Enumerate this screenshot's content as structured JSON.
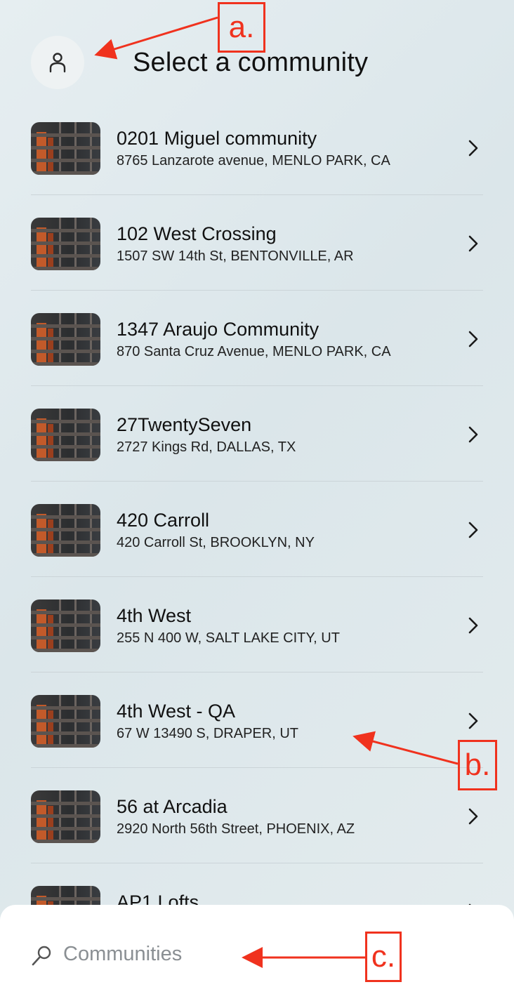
{
  "header": {
    "title": "Select a community",
    "profile_icon": "person-icon"
  },
  "communities": [
    {
      "name": "0201 Miguel community",
      "address": "8765 Lanzarote avenue, MENLO PARK, CA"
    },
    {
      "name": "102 West Crossing",
      "address": "1507 SW 14th St, BENTONVILLE, AR"
    },
    {
      "name": "1347 Araujo Community",
      "address": "870 Santa Cruz Avenue, MENLO PARK, CA"
    },
    {
      "name": "27TwentySeven",
      "address": "2727 Kings Rd, DALLAS, TX"
    },
    {
      "name": "420 Carroll",
      "address": "420 Carroll St, BROOKLYN, NY"
    },
    {
      "name": "4th West",
      "address": "255 N 400 W, SALT LAKE CITY, UT"
    },
    {
      "name": "4th West - QA",
      "address": "67 W 13490 S, DRAPER, UT"
    },
    {
      "name": "56 at Arcadia",
      "address": "2920 North 56th Street, PHOENIX, AZ"
    },
    {
      "name": "AP1 Lofts",
      "address": ""
    }
  ],
  "search": {
    "placeholder": "Communities",
    "icon": "search-icon"
  },
  "annotations": {
    "a": "a.",
    "b": "b.",
    "c": "c.",
    "color": "#f0321e"
  }
}
